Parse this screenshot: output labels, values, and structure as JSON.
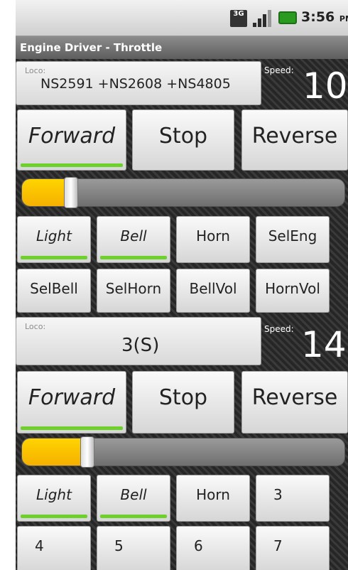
{
  "status_bar": {
    "network": "3G",
    "time": "3:56",
    "ampm": "PM",
    "icons": [
      "3g-icon",
      "signal-icon",
      "battery-icon"
    ]
  },
  "app": {
    "title": "Engine Driver - Throttle"
  },
  "throttles": [
    {
      "loco_caption": "Loco:",
      "loco_name": "NS2591 +NS2608 +NS4805",
      "speed_caption": "Speed:",
      "speed_value": "10",
      "forward_label": "Forward",
      "stop_label": "Stop",
      "reverse_label": "Reverse",
      "direction_selected": "Forward",
      "slider_fraction": 0.13,
      "functions": [
        {
          "label": "Light",
          "active": true
        },
        {
          "label": "Bell",
          "active": true
        },
        {
          "label": "Horn",
          "active": false
        },
        {
          "label": "SelEng",
          "active": false
        },
        {
          "label": "SelBell",
          "active": false
        },
        {
          "label": "SelHorn",
          "active": false
        },
        {
          "label": "BellVol",
          "active": false
        },
        {
          "label": "HornVol",
          "active": false
        }
      ]
    },
    {
      "loco_caption": "Loco:",
      "loco_name": "3(S)",
      "speed_caption": "Speed:",
      "speed_value": "14",
      "forward_label": "Forward",
      "stop_label": "Stop",
      "reverse_label": "Reverse",
      "direction_selected": "Forward",
      "slider_fraction": 0.18,
      "functions": [
        {
          "label": "Light",
          "active": true
        },
        {
          "label": "Bell",
          "active": true
        },
        {
          "label": "Horn",
          "active": false
        },
        {
          "label": "3",
          "active": false
        },
        {
          "label": "4",
          "active": false
        },
        {
          "label": "5",
          "active": false
        },
        {
          "label": "6",
          "active": false
        },
        {
          "label": "7",
          "active": false
        }
      ]
    }
  ],
  "colors": {
    "accent_active": "#6ed02b",
    "slider_fill": "#ffc400",
    "background": "#2c2c2c"
  }
}
